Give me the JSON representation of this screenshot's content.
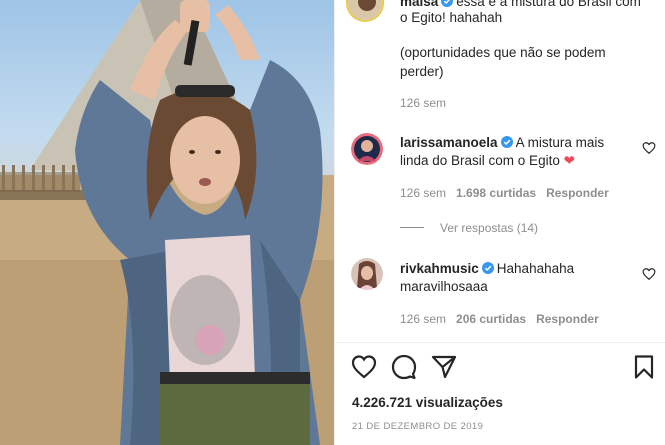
{
  "post": {
    "first_comment": {
      "username": "maisa",
      "line1": "essa é a mistura do Brasil com",
      "line2": "o Egito! hahahah",
      "line3": "(oportunidades que não se podem",
      "line4": "perder)",
      "age": "126 sem"
    },
    "comments": [
      {
        "username": "larissamanoela",
        "line1": "A mistura mais",
        "line2": "linda do Brasil com o Egito",
        "emoji": "❤",
        "age": "126 sem",
        "likes": "1.698 curtidas",
        "reply": "Responder",
        "view_replies": "Ver respostas (14)"
      },
      {
        "username": "rivkahmusic",
        "line1": "Hahahahaha",
        "line2": "maravilhosaaa",
        "age": "126 sem",
        "likes": "206 curtidas",
        "reply": "Responder"
      }
    ],
    "views": "4.226.721 visualizações",
    "date": "21 DE DEZEMBRO DE 2019",
    "icons": [
      "heart-icon",
      "comment-icon",
      "share-icon",
      "bookmark-icon"
    ],
    "colors": {
      "verified": "#3897f0",
      "heart": "#ed4956",
      "muted": "#8e8e8e"
    }
  }
}
